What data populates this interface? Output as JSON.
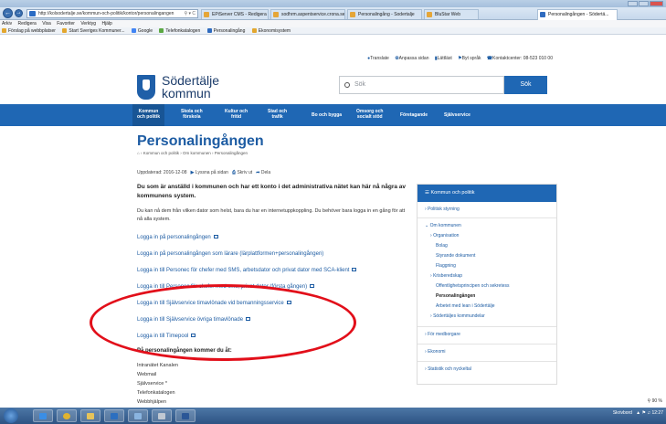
{
  "browser": {
    "url": "http://kolsodertalje.se/kommun-och-politik/kontor/personalingangen",
    "tabs": [
      "EPiServer CMS - Redigera",
      "sodhrm.aspentservice.crona.se",
      "Personalingång - Sodertalje",
      "BluStar Web",
      "Personalingången - Södertä..."
    ],
    "menu": [
      "Arkiv",
      "Redigera",
      "Visa",
      "Favoriter",
      "Verktyg",
      "Hjälp"
    ],
    "favorites": [
      "Förslag på webbplatser",
      "Start Sveriges Kommuner...",
      "Google",
      "Telefonkatalogen",
      "Personalingång",
      "Ekonomisystem"
    ],
    "zoom": "90 %"
  },
  "site": {
    "toplinks": [
      "Translate",
      "Anpassa sidan",
      "Lättläst",
      "Byt språk",
      "Kontaktcenter: 08-523 010 00"
    ],
    "brand_line1": "Södertälje",
    "brand_line2": "kommun",
    "search_placeholder": "Sök",
    "search_button": "Sök",
    "nav": [
      {
        "l1": "Kommun",
        "l2": "och politik"
      },
      {
        "l1": "Skola och",
        "l2": "förskola"
      },
      {
        "l1": "Kultur och",
        "l2": "fritid"
      },
      {
        "l1": "Stad och",
        "l2": "trafik"
      },
      {
        "l1": "Bo och bygga",
        "l2": ""
      },
      {
        "l1": "Omsorg och",
        "l2": "socialt stöd"
      },
      {
        "l1": "Företagande",
        "l2": ""
      },
      {
        "l1": "Självservice",
        "l2": ""
      }
    ]
  },
  "content": {
    "title": "Personalingången",
    "breadcrumb": "Kommun och politik  ›  Om kommunen  ›  Personalingången",
    "updated": "Uppdaterad: 2016-12-08",
    "listen": "Lyssna på sidan",
    "print": "Skriv ut",
    "share": "Dela",
    "lead": "Du som är anställd i kommunen och har ett konto i det administrativa nätet kan här nå några av kommunens system.",
    "para": "Du kan nå dem från vilken dator som helst, bara du har en internetuppkoppling. Du behöver bara logga in en gång för att nå alla system.",
    "links": [
      "Logga in på personalingången",
      "Logga in på personalingången som lärare (lärplattformen+personalingången)",
      "Logga in till Personec för chefer med SMS, arbetsdator och privat dator med SCA-klient",
      "Logga in till Personec för chefer med sms, privat dator (första gången)",
      "Logga in till Självservice timavlönade vid bemanningsservice",
      "Logga in till Självservice övriga timavlönade",
      "Logga in till Timepool"
    ],
    "subhead": "På personalingången kommer du åt:",
    "systems": [
      "Intranätet Kanalen",
      "Webmail",
      "Självservice *",
      "Telefonkatalogen",
      "Webbhjälpen"
    ]
  },
  "sidebar": {
    "header": "Kommun och politik",
    "items": [
      "Politisk styrning",
      "Om kommunen",
      "Organisation",
      "Bolag",
      "Styrande dokument",
      "Flaggning",
      "Krisberedskap",
      "Offentlighetsprincipen och sekretess",
      "Personalingången",
      "Arbetet med lean i Södertälje",
      "Södertäljes kommundelar",
      "För medborgare",
      "Ekonomi",
      "Statistik och nyckeltal"
    ]
  },
  "taskbar": {
    "tray_text": "Skrivbord",
    "clock": "12:27"
  },
  "colors": {
    "accent": "#1f67b4",
    "annotation": "#e20f1a",
    "link": "#1d5ca3"
  }
}
